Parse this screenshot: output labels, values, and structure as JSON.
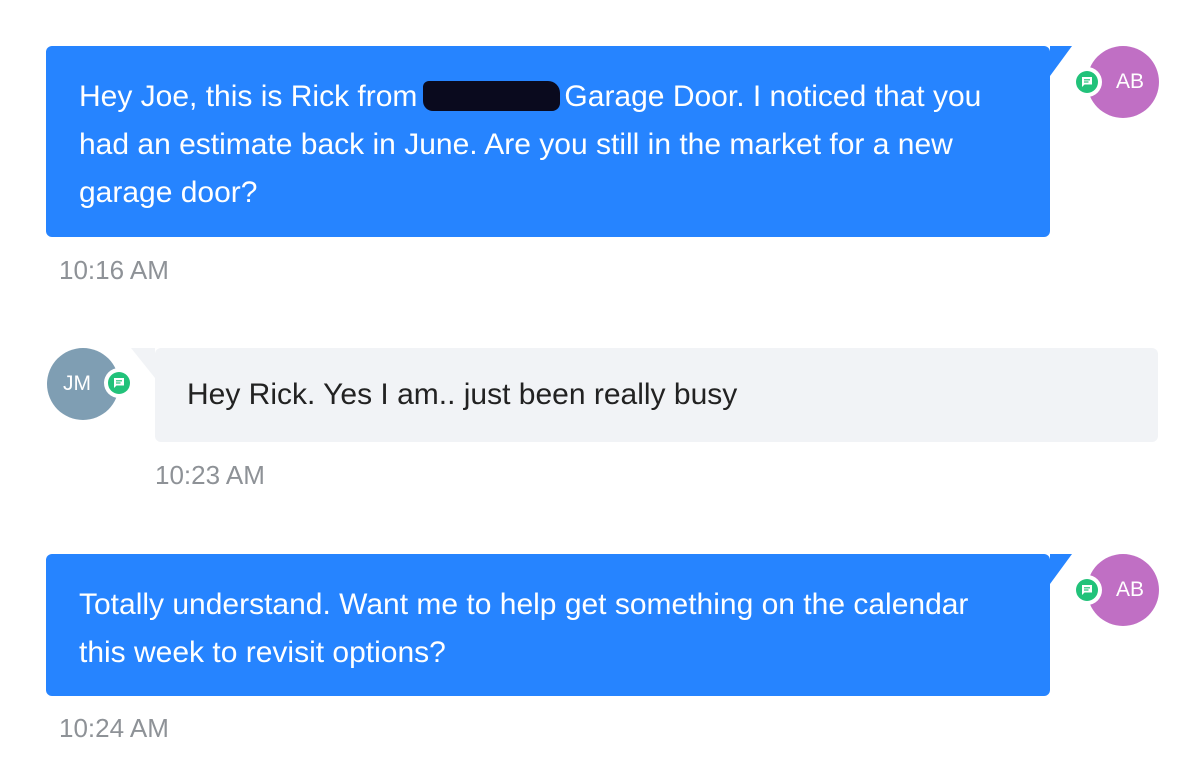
{
  "messages": [
    {
      "direction": "outgoing",
      "text_before_redaction": "Hey Joe, this is Rick from",
      "text_after_redaction": "Garage Door. I noticed that you had an estimate back in June. Are you still in the market for a new garage door?",
      "time": "10:16 AM",
      "avatar_initials": "AB",
      "channel_icon": "sms-icon"
    },
    {
      "direction": "incoming",
      "text": "Hey Rick. Yes I am.. just been really busy",
      "time": "10:23 AM",
      "avatar_initials": "JM",
      "channel_icon": "sms-icon"
    },
    {
      "direction": "outgoing",
      "text": "Totally understand. Want me to help get something on the calendar this week to revisit options?",
      "time": "10:24 AM",
      "avatar_initials": "AB",
      "channel_icon": "sms-icon"
    }
  ],
  "colors": {
    "outgoing_bubble": "#2684ff",
    "incoming_bubble": "#f1f3f6",
    "agent_avatar": "#c06fc4",
    "contact_avatar": "#7f9eb3",
    "channel_badge": "#22c27a",
    "timestamp": "#8e9297"
  }
}
